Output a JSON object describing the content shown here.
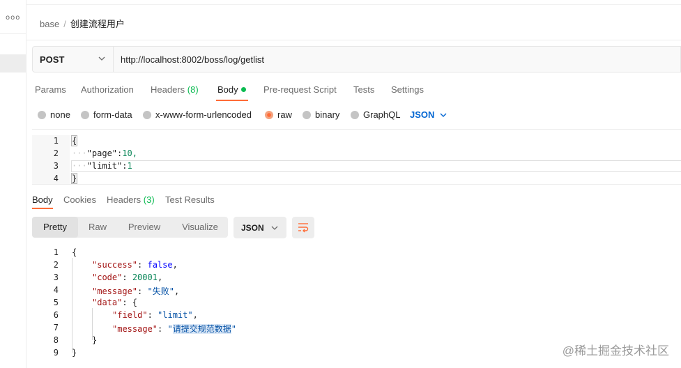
{
  "sidebar": {
    "more_label": "ooo"
  },
  "breadcrumb": {
    "collection": "base",
    "separator": "/",
    "request": "创建流程用户"
  },
  "request": {
    "method": "POST",
    "url": "http://localhost:8002/boss/log/getlist"
  },
  "request_tabs": [
    {
      "label": "Params"
    },
    {
      "label": "Authorization"
    },
    {
      "label": "Headers",
      "count": "(8)"
    },
    {
      "label": "Body",
      "active": true
    },
    {
      "label": "Pre-request Script"
    },
    {
      "label": "Tests"
    },
    {
      "label": "Settings"
    }
  ],
  "body_types": [
    {
      "label": "none"
    },
    {
      "label": "form-data"
    },
    {
      "label": "x-www-form-urlencoded"
    },
    {
      "label": "raw",
      "checked": true
    },
    {
      "label": "binary"
    },
    {
      "label": "GraphQL"
    }
  ],
  "raw_format": "JSON",
  "request_body_lines": [
    {
      "n": "1",
      "text": "{"
    },
    {
      "n": "2",
      "key": "\"page\"",
      "value": "10,"
    },
    {
      "n": "3",
      "key": "\"limit\"",
      "value": "1"
    },
    {
      "n": "4",
      "text": "}"
    }
  ],
  "response_tabs": [
    {
      "label": "Body",
      "active": true
    },
    {
      "label": "Cookies"
    },
    {
      "label": "Headers",
      "count": "(3)"
    },
    {
      "label": "Test Results"
    }
  ],
  "response_views": [
    {
      "label": "Pretty",
      "active": true
    },
    {
      "label": "Raw"
    },
    {
      "label": "Preview"
    },
    {
      "label": "Visualize"
    }
  ],
  "response_format": "JSON",
  "response_lines": {
    "ln": [
      "1",
      "2",
      "3",
      "4",
      "5",
      "6",
      "7",
      "8",
      "9"
    ],
    "open": "{",
    "success_key": "\"success\"",
    "success_val": "false",
    "code_key": "\"code\"",
    "code_val": "20001",
    "message_key": "\"message\"",
    "message_val": "\"失败\"",
    "data_key": "\"data\"",
    "field_key": "\"field\"",
    "field_val": "\"limit\"",
    "msg2_key": "\"message\"",
    "msg2_q1": "\"",
    "msg2_text": "请提交规范数据",
    "msg2_q2": "\"",
    "close_inner": "}",
    "close": "}"
  },
  "watermark": "@稀土掘金技术社区"
}
